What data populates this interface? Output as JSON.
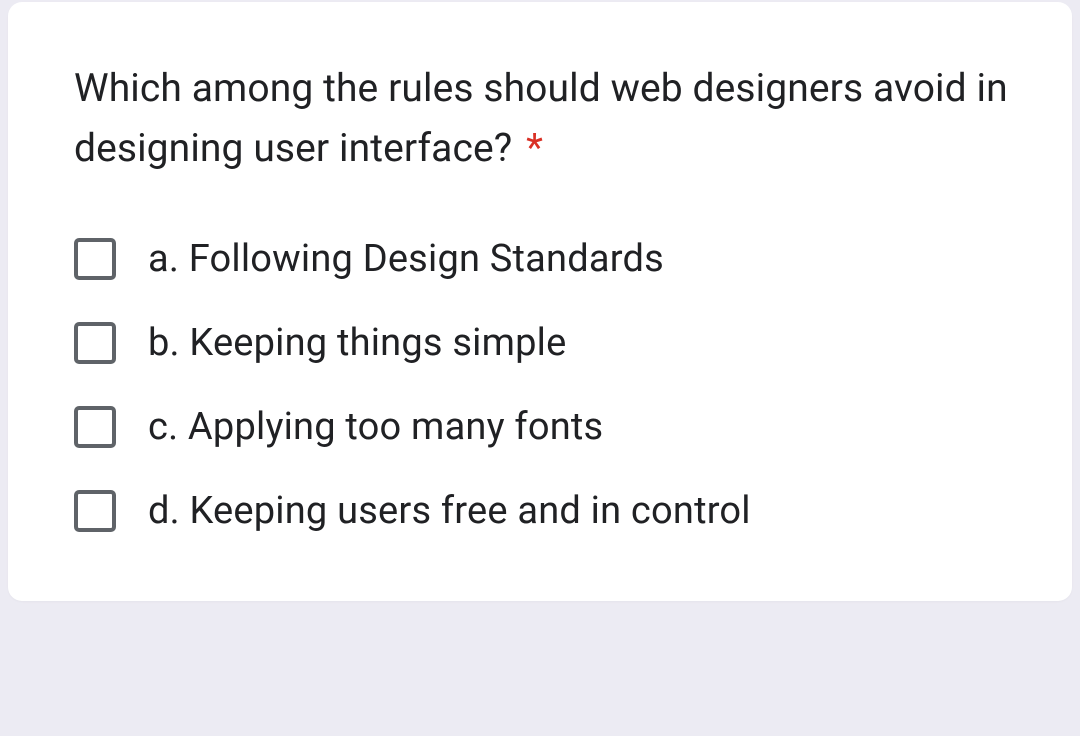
{
  "question": {
    "text": "Which among the rules should web designers avoid in designing user interface?",
    "required_marker": "*",
    "options": [
      {
        "label": "a. Following Design Standards"
      },
      {
        "label": "b. Keeping things simple"
      },
      {
        "label": "c. Applying too many fonts"
      },
      {
        "label": "d. Keeping users free and in control"
      }
    ]
  }
}
